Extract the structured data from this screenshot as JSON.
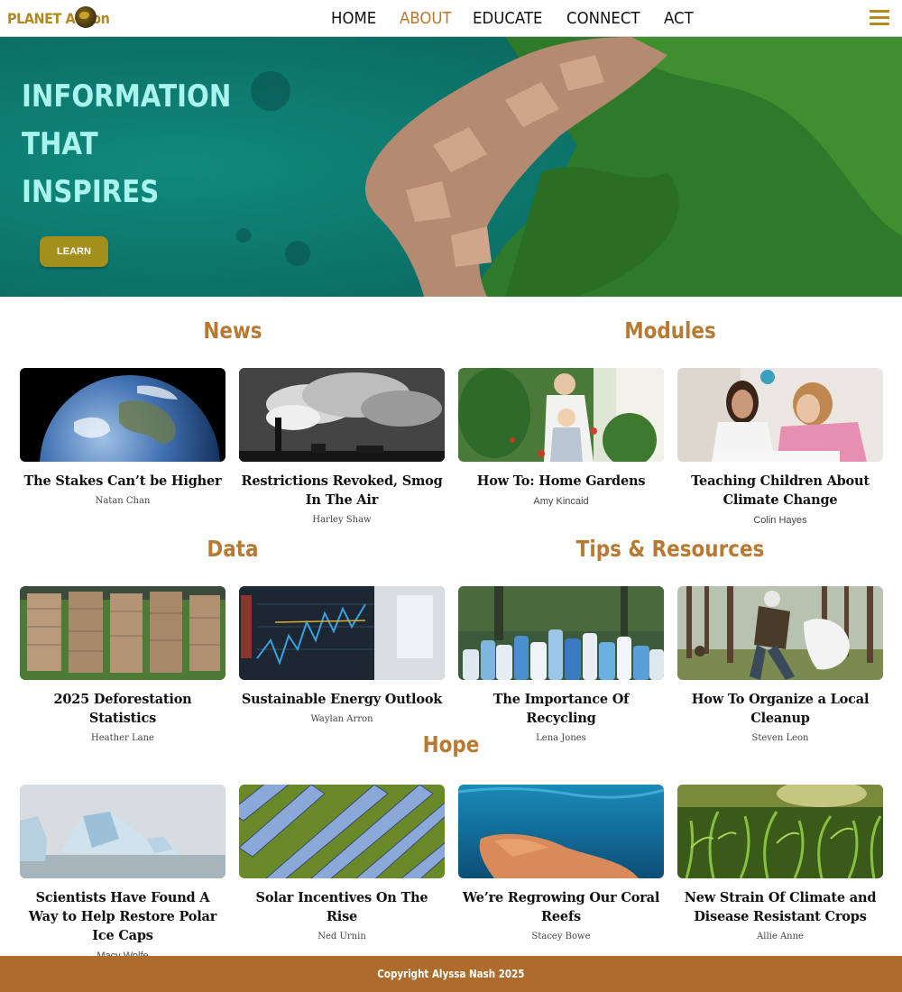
{
  "brand": {
    "logo_text": "PLANET Action"
  },
  "nav": {
    "links": [
      {
        "label": "HOME"
      },
      {
        "label": "ABOUT"
      },
      {
        "label": "EDUCATE"
      },
      {
        "label": "CONNECT"
      },
      {
        "label": "ACT"
      }
    ],
    "active_index": 1,
    "menu_icon": "hamburger-menu-icon"
  },
  "hero": {
    "title_lines": [
      "INFORMATION",
      "THAT",
      "INSPIRES"
    ],
    "button_label": "LEARN"
  },
  "sections": {
    "news": {
      "title": "News"
    },
    "modules": {
      "title": "Modules"
    },
    "data": {
      "title": "Data"
    },
    "tips": {
      "title": "Tips & Resources"
    },
    "hope": {
      "title": "Hope"
    }
  },
  "cards": {
    "news": [
      {
        "title": "The Stakes Can’t be Higher",
        "author": "Natan Chan",
        "image": "earth-from-space"
      },
      {
        "title": "Restrictions Revoked, Smog In The Air",
        "author": "Harley Shaw",
        "image": "smokestack-smog"
      }
    ],
    "modules": [
      {
        "title": "How To: Home Gardens",
        "author": "Amy Kincaid",
        "image": "family-gardening"
      },
      {
        "title": "Teaching Children About Climate Change",
        "author": "Colin Hayes",
        "image": "teacher-and-student"
      }
    ],
    "data": [
      {
        "title": "2025 Deforestation Statistics",
        "author": "Heather Lane",
        "image": "log-piles"
      },
      {
        "title": "Sustainable Energy Outlook",
        "author": "Waylan Arron",
        "image": "stock-chart-screen"
      }
    ],
    "tips": [
      {
        "title": "The Importance Of Recycling",
        "author": "Lena Jones",
        "image": "plastic-bottles"
      },
      {
        "title": "How To Organize a Local Cleanup",
        "author": "Steven Leon",
        "image": "forest-cleanup"
      }
    ],
    "hope": [
      {
        "title": "Scientists Have Found A Way to Help Restore Polar Ice Caps",
        "author": "Macy Wolfe",
        "image": "icebergs"
      },
      {
        "title": "Solar Incentives On The Rise",
        "author": "Ned Urnin",
        "image": "solar-panels"
      },
      {
        "title": "We’re Regrowing Our Coral Reefs",
        "author": "Stacey Bowe",
        "image": "coral-reef"
      },
      {
        "title": "New Strain Of Climate and Disease Resistant Crops",
        "author": "Allie Anne",
        "image": "corn-field"
      }
    ]
  },
  "footer": {
    "copyright": "Copyright Alyssa Nash 2025"
  },
  "colors": {
    "accent": "#b87a32",
    "logo": "#b08a1c",
    "hero_title": "#a9f4ee",
    "button": "#a38f1c",
    "footer": "#ad6b2c"
  }
}
